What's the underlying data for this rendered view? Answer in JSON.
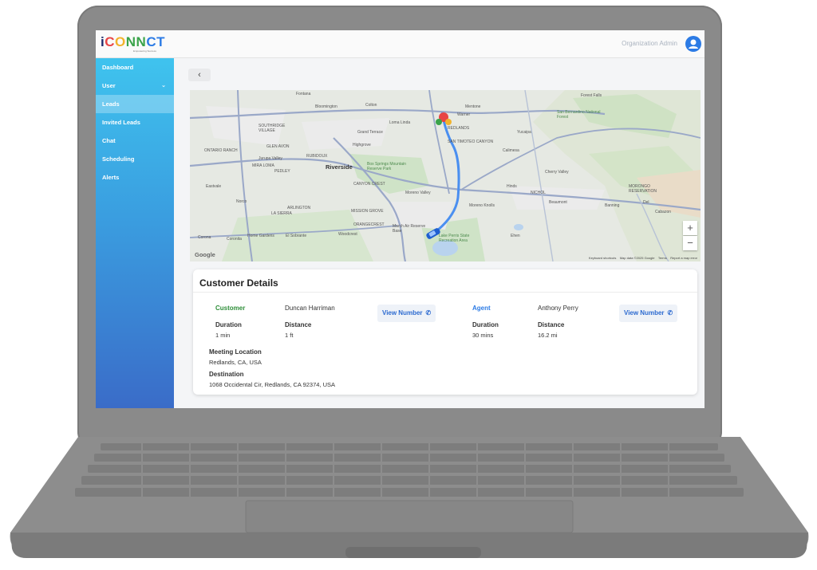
{
  "app": {
    "logo_parts": [
      "i",
      "C",
      "O",
      "NN",
      "CT"
    ],
    "logo_tagline": "Empowering Success",
    "role": "Organization Admin"
  },
  "sidebar": {
    "items": [
      {
        "label": "Dashboard",
        "active": false
      },
      {
        "label": "User",
        "active": false,
        "expandable": true
      },
      {
        "label": "Leads",
        "active": true
      },
      {
        "label": "Invited Leads",
        "active": false
      },
      {
        "label": "Chat",
        "active": false
      },
      {
        "label": "Scheduling",
        "active": false
      },
      {
        "label": "Alerts",
        "active": false
      }
    ]
  },
  "back_button": {
    "glyph": "‹"
  },
  "map": {
    "places": {
      "fontana": "Fontana",
      "bloomington": "Bloomington",
      "colton": "Colton",
      "mentone": "Mentone",
      "loma_linda": "Loma Linda",
      "grand_terrace": "Grand Terrace",
      "yucaipa": "Yucaipa",
      "highgrove": "Highgrove",
      "calimesa": "Calimesa",
      "riverside": "Riverside",
      "box_springs": "Box Springs Mountain Reserve Park",
      "cherry_valley": "Cherry Valley",
      "banning": "Banning",
      "moreno_valley": "Moreno Valley",
      "hinds": "Hinds",
      "beaumont": "Beaumont",
      "moreno_knolls": "Moreno Knolls",
      "norco": "Norco",
      "corona": "Corona",
      "woodcrest": "Woodcrest",
      "march_air": "March Air Reserve Base",
      "eastvale": "Eastvale",
      "san_bernardino_nf": "San Bernardino National Forest",
      "forest_falls": "Forest Falls",
      "morongo": "MORONGO RESERVATION",
      "cabazon": "Cabazon",
      "lake_perris": "Lake Perris State Recreation Area",
      "ontario_ranch": "ONTARIO RANCH",
      "jurupa_valley": "Jurupa Valley",
      "mira_loma": "MIRA LOMA",
      "pedley": "PEDLEY",
      "rubidoux": "RUBIDOUX",
      "glen_avon": "GLEN AVON",
      "canyon_crest": "CANYON CREST",
      "arlington": "ARLINGTON",
      "la_sierra": "LA SIERRA",
      "mission_grove": "MISSION GROVE",
      "orangecrest": "ORANGECREST",
      "home_gardens": "Home Gardens",
      "el_sobrante": "El Sobrante",
      "coronita": "Coronita",
      "southridge": "SOUTHRIDGE VILLAGE",
      "redlands": "REDLANDS",
      "san_timoteo": "SAN TIMOTEO CANYON",
      "warner": "Warner",
      "nichol": "NICHOL",
      "ehen": "Ehen",
      "del": "Del"
    },
    "google_label": "Google",
    "footer": [
      "Keyboard shortcuts",
      "Map data ©2025 Google",
      "Terms",
      "Report a map error"
    ],
    "zoom_in": "+",
    "zoom_out": "−"
  },
  "details": {
    "title": "Customer Details",
    "customer": {
      "role_label": "Customer",
      "name": "Duncan Harriman",
      "duration_label": "Duration",
      "duration": "1 min",
      "distance_label": "Distance",
      "distance": "1 ft",
      "button": "View Number"
    },
    "agent": {
      "role_label": "Agent",
      "name": "Anthony Perry",
      "duration_label": "Duration",
      "duration": "30 mins",
      "distance_label": "Distance",
      "distance": "16.2 mi",
      "button": "View Number"
    },
    "meeting_location_label": "Meeting Location",
    "meeting_location": "Redlands, CA, USA",
    "destination_label": "Destination",
    "destination": "1068 Occidental Cir, Redlands, CA 92374, USA"
  },
  "colors": {
    "sidebar_top": "#3fc3ee",
    "sidebar_bottom": "#3a6cc8",
    "customer": "#2f8f3a",
    "agent": "#2c7be5",
    "route": "#4a8ff0"
  }
}
